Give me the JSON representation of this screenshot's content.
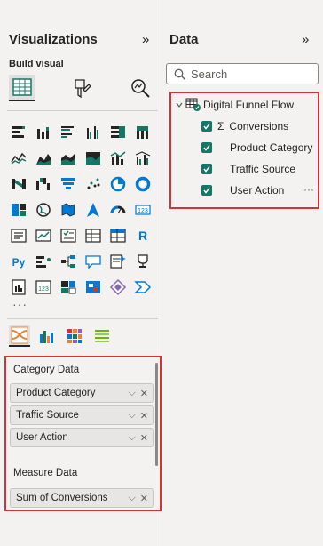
{
  "visualizations": {
    "title": "Visualizations",
    "collapse_glyph": "»",
    "build_label": "Build visual",
    "more_glyph": "···",
    "wells": {
      "category_title": "Category Data",
      "category_fields": [
        "Product Category",
        "Traffic Source",
        "User Action"
      ],
      "measure_title": "Measure Data",
      "measure_fields": [
        "Sum of Conversions"
      ]
    }
  },
  "data": {
    "title": "Data",
    "collapse_glyph": "»",
    "search_placeholder": "Search",
    "table_name": "Digital Funnel Flow",
    "fields": [
      "Conversions",
      "Product Category",
      "Traffic Source",
      "User Action"
    ],
    "measure_glyph": "Σ",
    "more_glyph": "···"
  },
  "colors": {
    "accent_red": "#d13438",
    "checkbox_green": "#117865",
    "pane_bg": "#f3f2f1"
  }
}
